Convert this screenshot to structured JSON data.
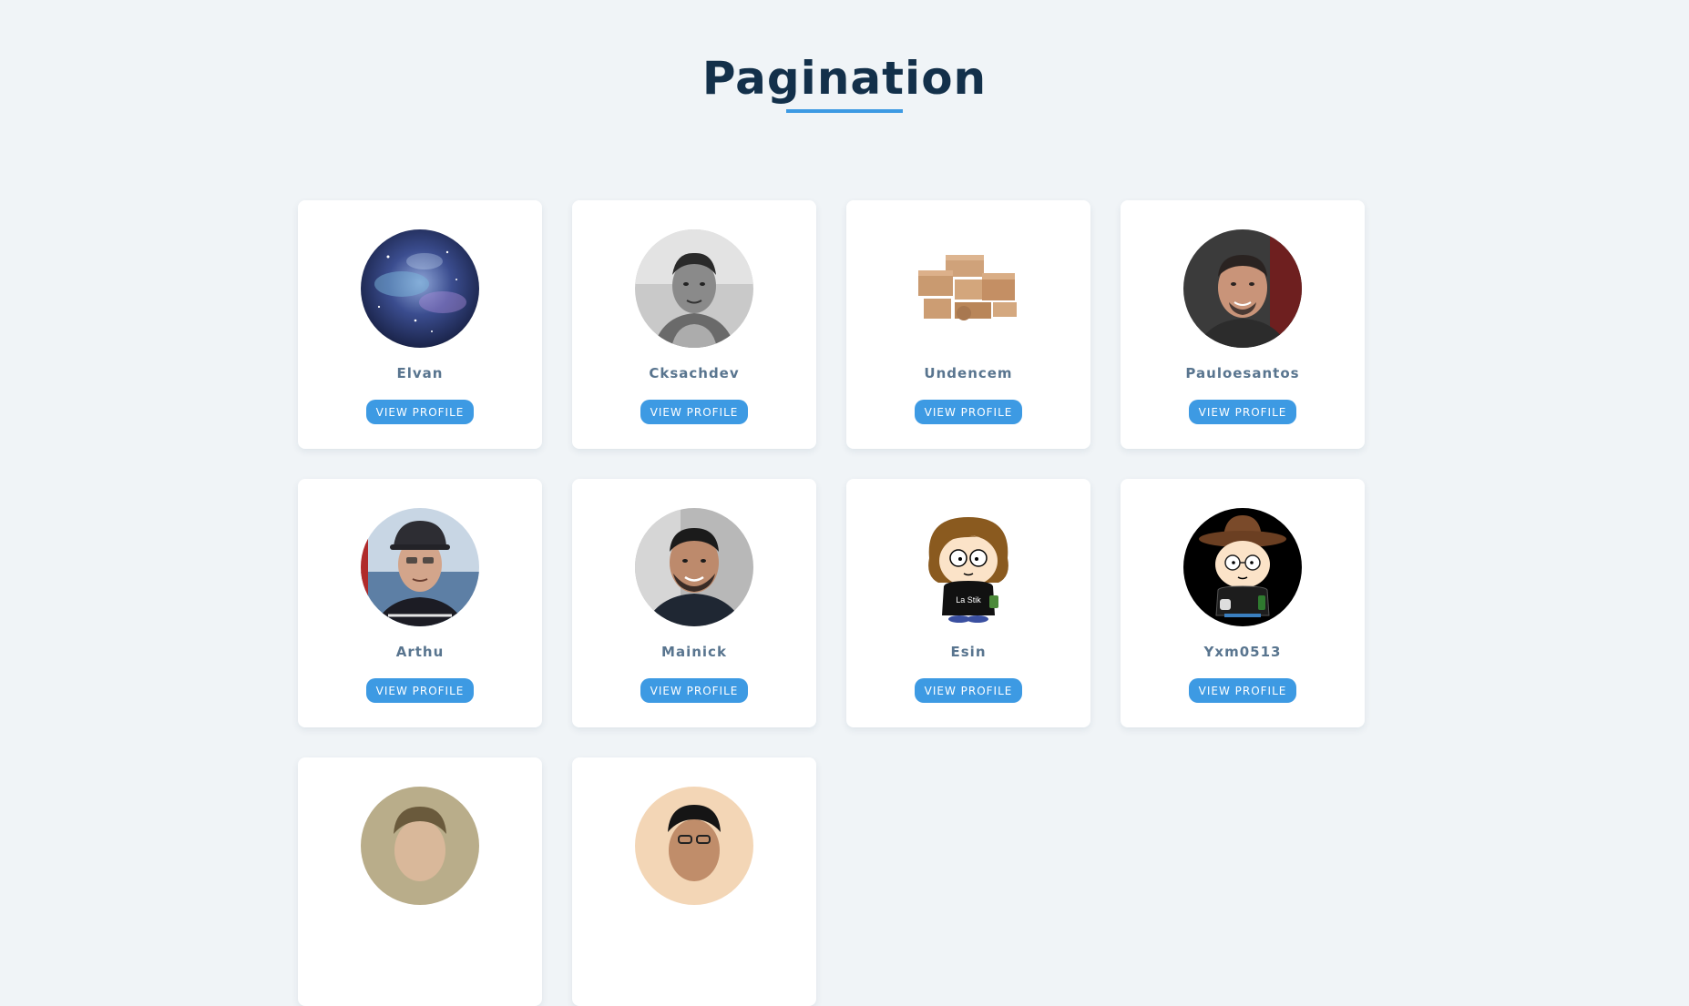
{
  "header": {
    "title": "Pagination"
  },
  "profiles": [
    {
      "name": "Elvan",
      "button_label": "VIEW PROFILE",
      "avatar": "galaxy-avatar"
    },
    {
      "name": "Cksachdev",
      "button_label": "VIEW PROFILE",
      "avatar": "man-portrait-avatar"
    },
    {
      "name": "Undencem",
      "button_label": "VIEW PROFILE",
      "avatar": "boxes-avatar"
    },
    {
      "name": "Pauloesantos",
      "button_label": "VIEW PROFILE",
      "avatar": "man-portrait-avatar"
    },
    {
      "name": "Arthu",
      "button_label": "VIEW PROFILE",
      "avatar": "man-with-cap-avatar"
    },
    {
      "name": "Mainick",
      "button_label": "VIEW PROFILE",
      "avatar": "man-portrait-avatar"
    },
    {
      "name": "Esin",
      "button_label": "VIEW PROFILE",
      "avatar": "cartoon-avatar"
    },
    {
      "name": "Yxm0513",
      "button_label": "VIEW PROFILE",
      "avatar": "cartoon-hat-avatar"
    },
    {
      "name": "",
      "button_label": "",
      "avatar": "man-portrait-avatar"
    },
    {
      "name": "",
      "button_label": "",
      "avatar": "man-with-glasses-avatar"
    }
  ],
  "cartoon_shirt_text": "La Stik",
  "colors": {
    "background": "#f0f4f7",
    "title": "#13304a",
    "accent": "#3d9ae3",
    "name_text": "#59758f",
    "card": "#ffffff"
  }
}
